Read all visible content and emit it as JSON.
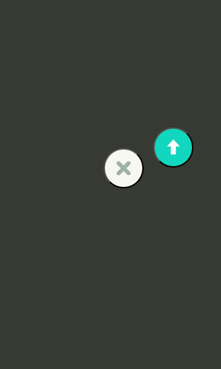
{
  "screen": {
    "background_color": "#363a33"
  },
  "actions": {
    "close": {
      "icon": "close-icon",
      "background_color": "#f7f7f2",
      "icon_color": "#9fb19f"
    },
    "upload": {
      "icon": "arrow-up-icon",
      "background_color": "#12d6bd",
      "icon_color": "#ffffff"
    }
  }
}
